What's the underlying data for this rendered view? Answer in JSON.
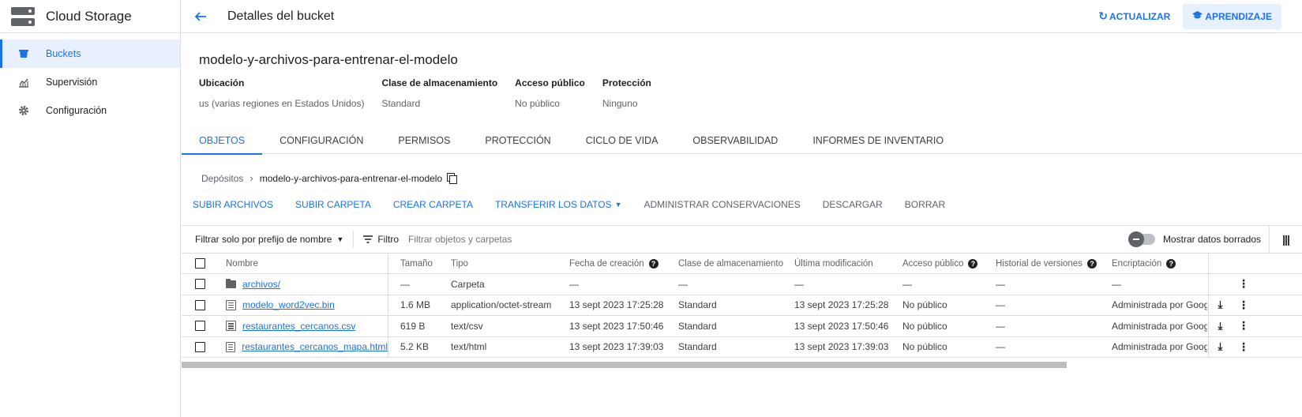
{
  "sidebar": {
    "title": "Cloud Storage",
    "items": [
      {
        "label": "Buckets"
      },
      {
        "label": "Supervisión"
      },
      {
        "label": "Configuración"
      }
    ]
  },
  "topbar": {
    "title": "Detalles del bucket",
    "refresh": "ACTUALIZAR",
    "learn": "APRENDIZAJE"
  },
  "bucket": {
    "name": "modelo-y-archivos-para-entrenar-el-modelo",
    "props": [
      {
        "label": "Ubicación",
        "value": "us (varias regiones en Estados Unidos)"
      },
      {
        "label": "Clase de almacenamiento",
        "value": "Standard"
      },
      {
        "label": "Acceso público",
        "value": "No público"
      },
      {
        "label": "Protección",
        "value": "Ninguno"
      }
    ]
  },
  "tabs": [
    "OBJETOS",
    "CONFIGURACIÓN",
    "PERMISOS",
    "PROTECCIÓN",
    "CICLO DE VIDA",
    "OBSERVABILIDAD",
    "INFORMES DE INVENTARIO"
  ],
  "breadcrumb": {
    "root": "Depósitos",
    "current": "modelo-y-archivos-para-entrenar-el-modelo"
  },
  "actions": [
    {
      "label": "SUBIR ARCHIVOS"
    },
    {
      "label": "SUBIR CARPETA"
    },
    {
      "label": "CREAR CARPETA"
    },
    {
      "label": "TRANSFERIR LOS DATOS"
    },
    {
      "label": "ADMINISTRAR CONSERVACIONES"
    },
    {
      "label": "DESCARGAR"
    },
    {
      "label": "BORRAR"
    }
  ],
  "filter": {
    "prefix": "Filtrar solo por prefijo de nombre",
    "label": "Filtro",
    "placeholder": "Filtrar objetos y carpetas",
    "toggle_label": "Mostrar datos borrados"
  },
  "table": {
    "headers": {
      "name": "Nombre",
      "size": "Tamaño",
      "type": "Tipo",
      "created": "Fecha de creación",
      "class": "Clase de almacenamiento",
      "modified": "Última modificación",
      "public": "Acceso público",
      "history": "Historial de versiones",
      "encryption": "Encriptación"
    },
    "rows": [
      {
        "name": "archivos/",
        "size": "—",
        "type": "Carpeta",
        "created": "—",
        "class": "—",
        "modified": "—",
        "public": "—",
        "history": "—",
        "encryption": "—"
      },
      {
        "name": "modelo_word2vec.bin",
        "size": "1.6 MB",
        "type": "application/octet-stream",
        "created": "13 sept 2023 17:25:28",
        "class": "Standard",
        "modified": "13 sept 2023 17:25:28",
        "public": "No público",
        "history": "—",
        "encryption": "Administrada por Google"
      },
      {
        "name": "restaurantes_cercanos.csv",
        "size": "619 B",
        "type": "text/csv",
        "created": "13 sept 2023 17:50:46",
        "class": "Standard",
        "modified": "13 sept 2023 17:50:46",
        "public": "No público",
        "history": "—",
        "encryption": "Administrada por Google"
      },
      {
        "name": "restaurantes_cercanos_mapa.html",
        "size": "5.2 KB",
        "type": "text/html",
        "created": "13 sept 2023 17:39:03",
        "class": "Standard",
        "modified": "13 sept 2023 17:39:03",
        "public": "No público",
        "history": "—",
        "encryption": "Administrada por Google"
      }
    ]
  }
}
